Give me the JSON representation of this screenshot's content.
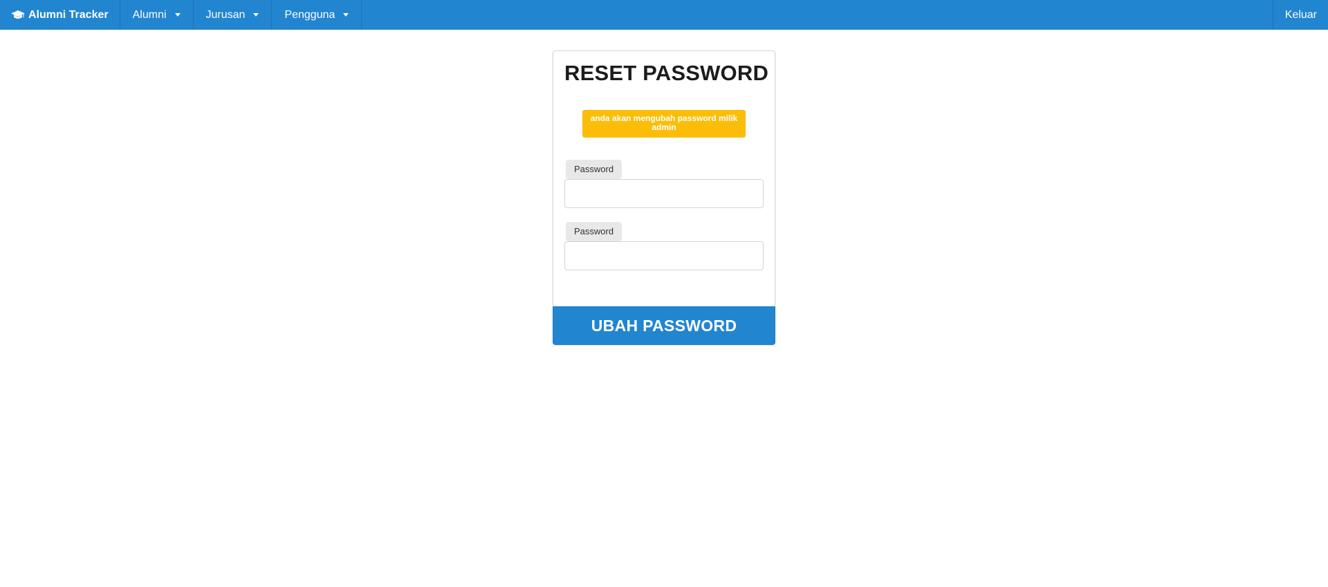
{
  "navbar": {
    "brand": "Alumni Tracker",
    "brand_icon": "graduation-cap-icon",
    "menus": [
      {
        "label": "Alumni"
      },
      {
        "label": "Jurusan"
      },
      {
        "label": "Pengguna"
      }
    ],
    "logout_label": "Keluar",
    "background_color": "#2185d0"
  },
  "form": {
    "title": "RESET PASSWORD",
    "warning": "anda akan mengubah password milik admin",
    "warning_color": "#fbbd08",
    "fields": [
      {
        "label": "Password",
        "value": "",
        "placeholder": ""
      },
      {
        "label": "Password",
        "value": "",
        "placeholder": ""
      }
    ],
    "submit_label": "UBAH PASSWORD"
  }
}
